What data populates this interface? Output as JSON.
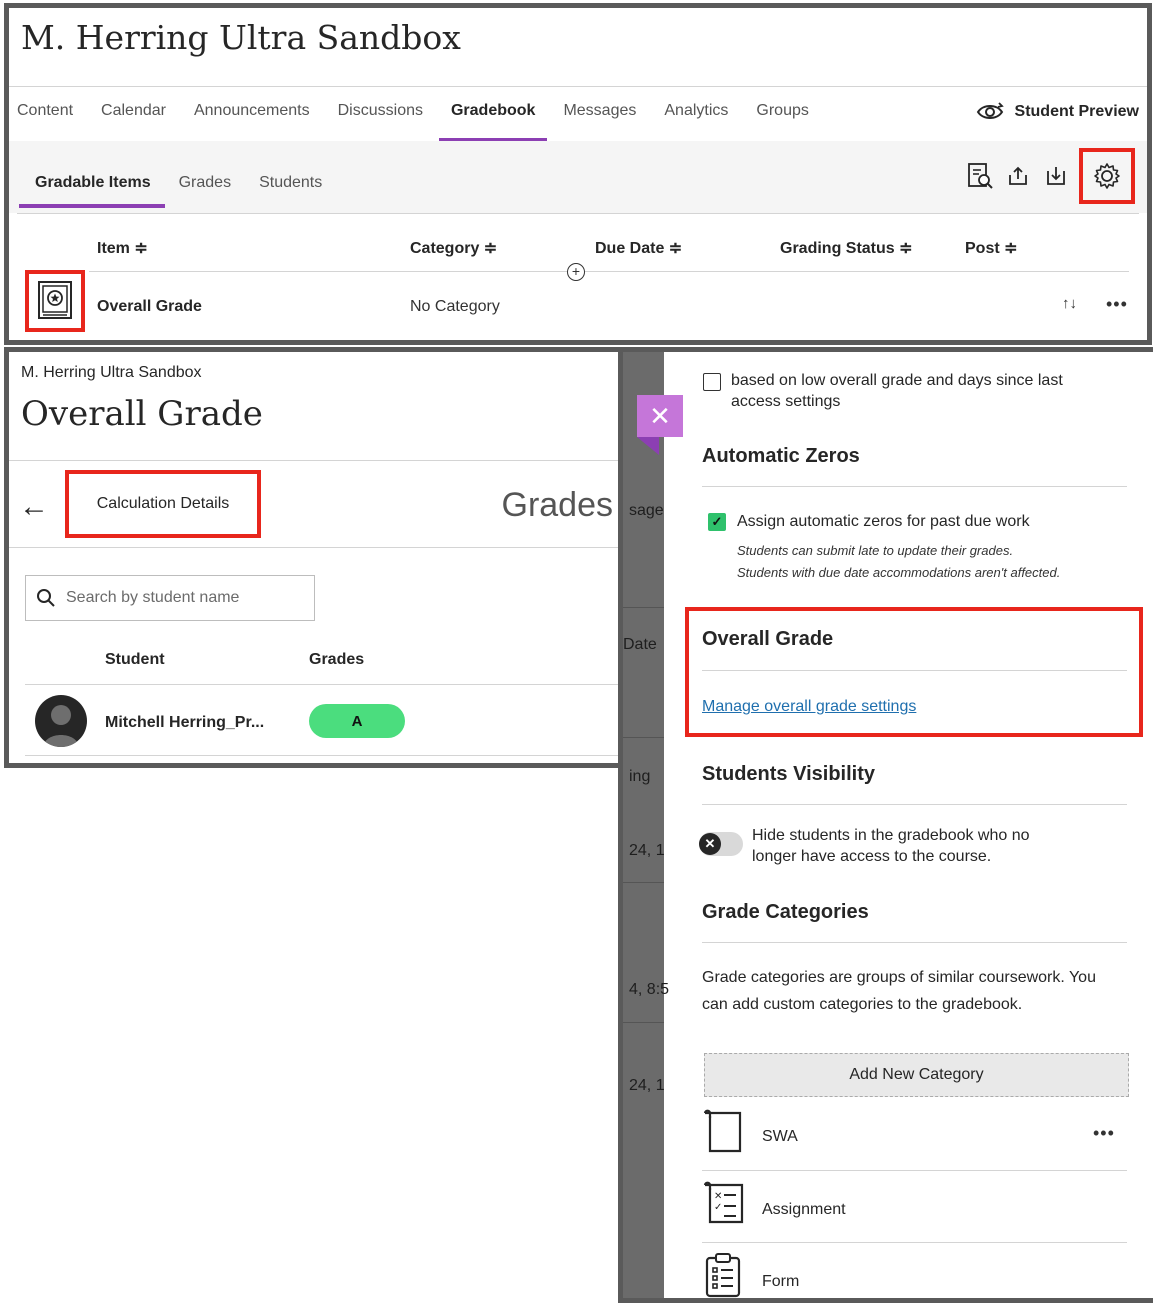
{
  "panel1": {
    "course_title": "M. Herring Ultra Sandbox",
    "nav": [
      "Content",
      "Calendar",
      "Announcements",
      "Discussions",
      "Gradebook",
      "Messages",
      "Analytics",
      "Groups"
    ],
    "nav_active": "Gradebook",
    "student_preview": "Student Preview",
    "subtabs": [
      "Gradable Items",
      "Grades",
      "Students"
    ],
    "columns": {
      "item": "Item ≑",
      "category": "Category ≑",
      "due_date": "Due Date ≑",
      "grading_status": "Grading Status ≑",
      "post": "Post ≑"
    },
    "row": {
      "item": "Overall Grade",
      "category": "No Category"
    },
    "icons": [
      "grade-review-icon",
      "upload-icon",
      "download-icon",
      "gear-icon"
    ]
  },
  "panel2": {
    "breadcrumb": "M. Herring Ultra Sandbox",
    "title": "Overall Grade",
    "calc_tab": "Calculation Details",
    "grades_label": "Grades",
    "search_placeholder": "Search by student name",
    "col_student": "Student",
    "col_grades": "Grades",
    "student_name": "Mitchell Herring_Pr...",
    "grade": "A"
  },
  "panel3": {
    "dim_fragments": [
      "sage",
      "Date",
      "ing",
      "24, 1",
      "4, 8:5",
      "24, 1"
    ],
    "notif_text_1": "based on low overall grade and days since last",
    "notif_text_2": "access settings",
    "auto_zeros_heading": "Automatic Zeros",
    "auto_zeros_label": "Assign automatic zeros for past due work",
    "auto_zeros_note1": "Students can submit late to update their grades.",
    "auto_zeros_note2": "Students with due date accommodations aren't affected.",
    "overall_heading": "Overall Grade",
    "overall_link": "Manage overall grade settings",
    "visibility_heading": "Students Visibility",
    "visibility_text_1": "Hide students in the gradebook who no",
    "visibility_text_2": "longer have access to the course.",
    "categories_heading": "Grade Categories",
    "categories_desc_1": "Grade categories are groups of similar coursework. You",
    "categories_desc_2": "can add custom categories to the gradebook.",
    "add_category": "Add New Category",
    "categories": [
      "SWA",
      "Assignment",
      "Form"
    ],
    "accent_purple": "#8c3fb3",
    "highlight_red": "#e8261c",
    "grade_green": "#4bdd7e"
  }
}
